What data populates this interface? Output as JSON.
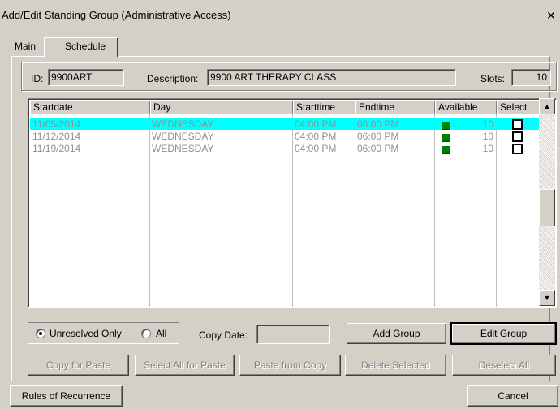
{
  "window": {
    "title": "Add/Edit Standing Group (Administrative Access)",
    "close_glyph": "✕"
  },
  "tabs": [
    {
      "label": "Main",
      "active": false
    },
    {
      "label": "Schedule",
      "active": true
    }
  ],
  "header": {
    "id_label": "ID:",
    "id_value": "9900ART",
    "description_label": "Description:",
    "description_value": "9900 ART THERAPY CLASS",
    "slots_label": "Slots:",
    "slots_value": "10"
  },
  "grid": {
    "columns": [
      "Startdate",
      "Day",
      "Starttime",
      "Endtime",
      "Available",
      "Select"
    ],
    "rows": [
      {
        "startdate": "11/05/2014",
        "day": "WEDNESDAY",
        "starttime": "04:00 PM",
        "endtime": "06:00 PM",
        "available": "10",
        "selected": true
      },
      {
        "startdate": "11/12/2014",
        "day": "WEDNESDAY",
        "starttime": "04:00 PM",
        "endtime": "06:00 PM",
        "available": "10",
        "selected": false
      },
      {
        "startdate": "11/19/2014",
        "day": "WEDNESDAY",
        "starttime": "04:00 PM",
        "endtime": "06:00 PM",
        "available": "10",
        "selected": false
      }
    ],
    "selected_row_color": "#00ffff",
    "available_indicator_color": "#008000"
  },
  "filter": {
    "unresolved_label": "Unresolved Only",
    "all_label": "All",
    "selected": "Unresolved Only"
  },
  "copy_date": {
    "label": "Copy Date:",
    "value": ""
  },
  "buttons": {
    "add_group": "Add Group",
    "edit_group": "Edit Group",
    "copy_for_paste": "Copy for Paste",
    "select_all_for_paste": "Select All for Paste",
    "paste_from_copy": "Paste from Copy",
    "delete_selected": "Delete Selected",
    "deselect_all": "Deselect All",
    "rules_of_recurrence": "Rules of Recurrence",
    "cancel": "Cancel"
  }
}
